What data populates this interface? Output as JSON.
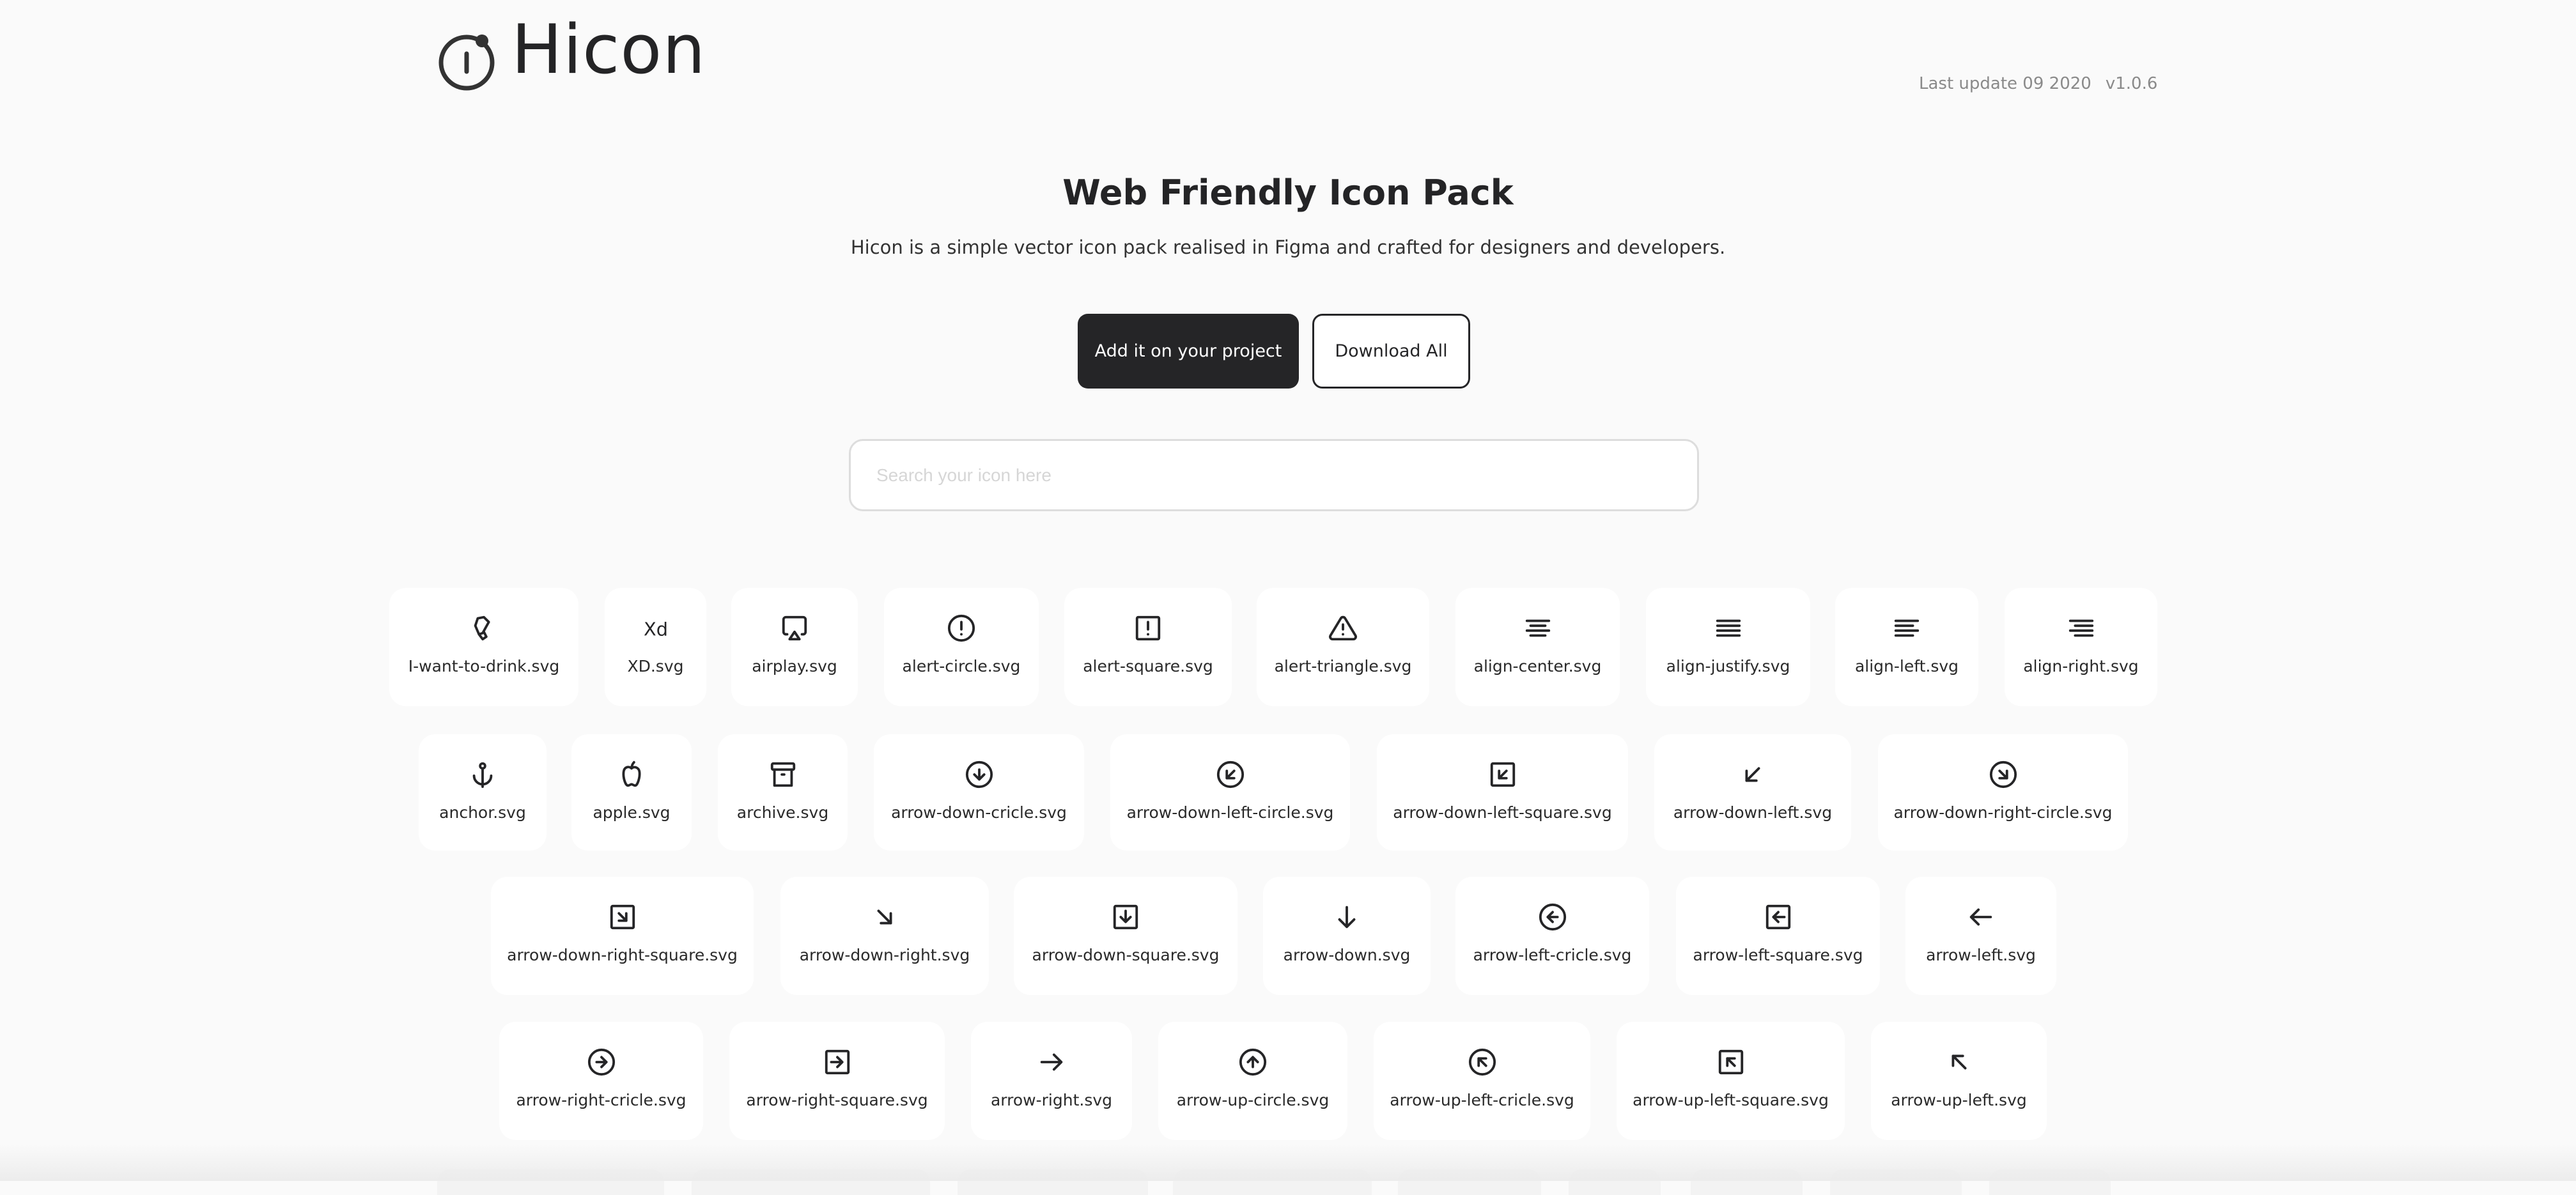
{
  "header": {
    "brand": "Hicon",
    "last_update": "Last update 09 2020",
    "version": "v1.0.6"
  },
  "hero": {
    "title": "Web Friendly Icon Pack",
    "subtitle": "Hicon is a simple vector icon pack realised in Figma and crafted for designers and developers.",
    "primary_button": "Add it on your project",
    "secondary_button": "Download All"
  },
  "search": {
    "placeholder": "Search your icon here",
    "value": ""
  },
  "colors": {
    "background": "#fafafa",
    "text": "#242426",
    "primary_button": "#252527",
    "muted": "#8a8a8a"
  },
  "icons": [
    {
      "label": "I-want-to-drink.svg",
      "icon": "glass-icon"
    },
    {
      "label": "XD.svg",
      "icon": "xd-icon"
    },
    {
      "label": "airplay.svg",
      "icon": "airplay-icon"
    },
    {
      "label": "alert-circle.svg",
      "icon": "alert-circle-icon"
    },
    {
      "label": "alert-square.svg",
      "icon": "alert-square-icon"
    },
    {
      "label": "alert-triangle.svg",
      "icon": "alert-triangle-icon"
    },
    {
      "label": "align-center.svg",
      "icon": "align-center-icon"
    },
    {
      "label": "align-justify.svg",
      "icon": "align-justify-icon"
    },
    {
      "label": "align-left.svg",
      "icon": "align-left-icon"
    },
    {
      "label": "align-right.svg",
      "icon": "align-right-icon"
    },
    {
      "label": "anchor.svg",
      "icon": "anchor-icon"
    },
    {
      "label": "apple.svg",
      "icon": "apple-icon"
    },
    {
      "label": "archive.svg",
      "icon": "archive-icon"
    },
    {
      "label": "arrow-down-cricle.svg",
      "icon": "arrow-down-circle-icon"
    },
    {
      "label": "arrow-down-left-circle.svg",
      "icon": "arrow-down-left-circle-icon"
    },
    {
      "label": "arrow-down-left-square.svg",
      "icon": "arrow-down-left-square-icon"
    },
    {
      "label": "arrow-down-left.svg",
      "icon": "arrow-down-left-icon"
    },
    {
      "label": "arrow-down-right-circle.svg",
      "icon": "arrow-down-right-circle-icon"
    },
    {
      "label": "arrow-down-right-square.svg",
      "icon": "arrow-down-right-square-icon"
    },
    {
      "label": "arrow-down-right.svg",
      "icon": "arrow-down-right-icon"
    },
    {
      "label": "arrow-down-square.svg",
      "icon": "arrow-down-square-icon"
    },
    {
      "label": "arrow-down.svg",
      "icon": "arrow-down-icon"
    },
    {
      "label": "arrow-left-cricle.svg",
      "icon": "arrow-left-circle-icon"
    },
    {
      "label": "arrow-left-square.svg",
      "icon": "arrow-left-square-icon"
    },
    {
      "label": "arrow-left.svg",
      "icon": "arrow-left-icon"
    },
    {
      "label": "arrow-right-cricle.svg",
      "icon": "arrow-right-circle-icon"
    },
    {
      "label": "arrow-right-square.svg",
      "icon": "arrow-right-square-icon"
    },
    {
      "label": "arrow-right.svg",
      "icon": "arrow-right-icon"
    },
    {
      "label": "arrow-up-circle.svg",
      "icon": "arrow-up-circle-icon"
    },
    {
      "label": "arrow-up-left-cricle.svg",
      "icon": "arrow-up-left-circle-icon"
    },
    {
      "label": "arrow-up-left-square.svg",
      "icon": "arrow-up-left-square-icon"
    },
    {
      "label": "arrow-up-left.svg",
      "icon": "arrow-up-left-icon"
    }
  ]
}
